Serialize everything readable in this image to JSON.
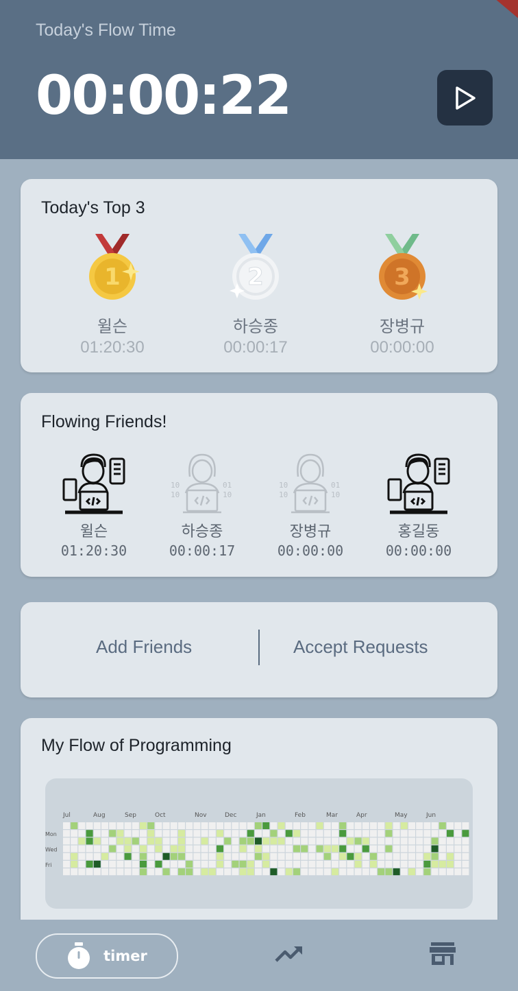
{
  "header": {
    "label": "Today's Flow Time",
    "time": "00:00:22"
  },
  "top3": {
    "title": "Today's Top 3",
    "entries": [
      {
        "rank": "1",
        "name": "윌슨",
        "time": "01:20:30",
        "medal": "gold",
        "ribbon": "#c23a3a"
      },
      {
        "rank": "2",
        "name": "하승종",
        "time": "00:00:17",
        "medal": "silver",
        "ribbon": "#6ea7e8"
      },
      {
        "rank": "3",
        "name": "장병규",
        "time": "00:00:00",
        "medal": "bronze",
        "ribbon": "#6fba8a"
      }
    ]
  },
  "friends": {
    "title": "Flowing Friends!",
    "items": [
      {
        "name": "윌슨",
        "time": "01:20:30",
        "active": true
      },
      {
        "name": "하승종",
        "time": "00:00:17",
        "active": false
      },
      {
        "name": "장병규",
        "time": "00:00:00",
        "active": false
      },
      {
        "name": "홍길동",
        "time": "00:00:00",
        "active": true
      }
    ]
  },
  "actions": {
    "add": "Add Friends",
    "accept": "Accept Requests"
  },
  "flow": {
    "title": "My Flow of Programming",
    "months": [
      "Jul",
      "Aug",
      "Sep",
      "Oct",
      "Nov",
      "Dec",
      "Jan",
      "Feb",
      "Mar",
      "Apr",
      "May",
      "Jun"
    ],
    "days": [
      "Mon",
      "Wed",
      "Fri"
    ]
  },
  "nav": {
    "timer_label": "timer",
    "icons": [
      "stopwatch-icon",
      "trending-up-icon",
      "storefront-icon"
    ]
  },
  "colors": {
    "header": "#5a6f85",
    "background": "#9fb0bf",
    "card": "#e1e7ec",
    "heat": [
      "#f0f0f0",
      "#d6eba0",
      "#a3d17a",
      "#4a9a3d",
      "#1e5c27"
    ]
  }
}
